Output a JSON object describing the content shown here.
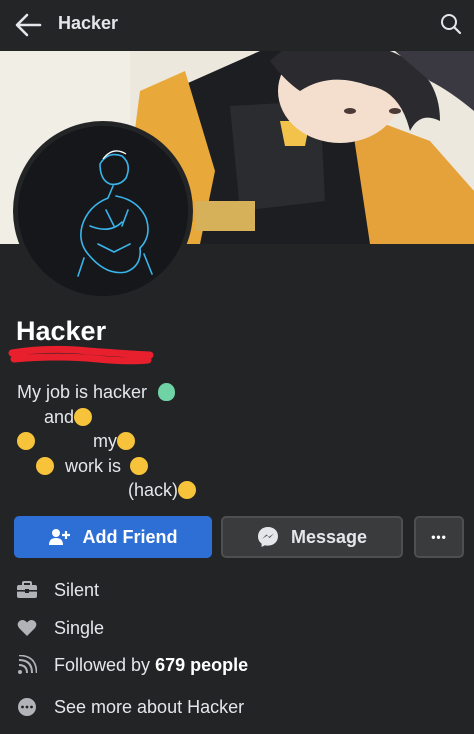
{
  "header": {
    "title": "Hacker"
  },
  "profile": {
    "name": "Hacker",
    "bio": {
      "line1": "My job is hacker",
      "line2": "and",
      "line3": "my",
      "line4": "work is",
      "line5": "(hack)"
    }
  },
  "actions": {
    "add_friend": "Add Friend",
    "message": "Message",
    "more": "•••"
  },
  "info": {
    "work": "Silent",
    "relationship": "Single",
    "followed_prefix": "Followed by ",
    "followed_count": "679 people",
    "see_more": "See more about Hacker"
  },
  "colors": {
    "background": "#232425",
    "primary_button": "#2d6fd4",
    "secondary_button": "#3a3b3c"
  },
  "icons": [
    "back-arrow-icon",
    "search-icon",
    "add-friend-icon",
    "messenger-icon",
    "more-icon",
    "briefcase-icon",
    "heart-icon",
    "rss-icon",
    "ellipsis-circle-icon"
  ]
}
